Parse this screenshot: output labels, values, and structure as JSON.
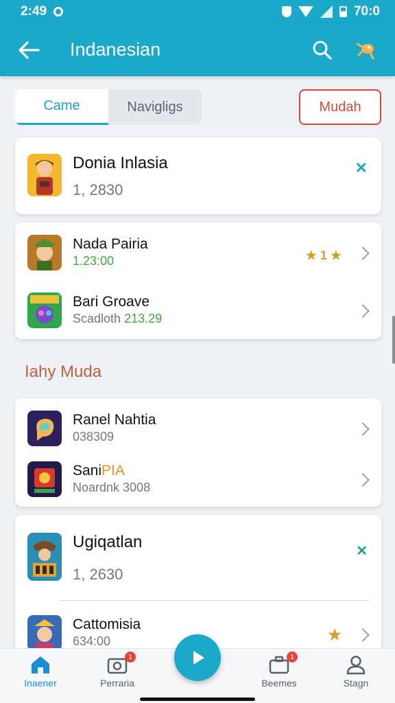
{
  "status_bar": {
    "time": "2:49",
    "battery_text": "70:0"
  },
  "app_bar": {
    "title": "Indanesian",
    "back_icon": "arrow-left-icon",
    "search_icon": "search-icon",
    "extra_icon": "bug-icon"
  },
  "tabs": [
    {
      "label": "Came",
      "active": true
    },
    {
      "label": "Navigligs",
      "active": false
    }
  ],
  "mudah_button": "Mudah",
  "featured": {
    "name": "Donia Inlasia",
    "sub": "1, 2830"
  },
  "list1": [
    {
      "name": "Nada Pairia",
      "sub": "1.23:00",
      "rating": "★ 1 ★"
    },
    {
      "name": "Bari Groave",
      "sub_a": "Scadloth",
      "sub_b": "213.29"
    }
  ],
  "section_title": "Iahy Muda",
  "list2": [
    {
      "name": "Ranel Nahtia",
      "sub": "038309"
    },
    {
      "name_a": "Sani",
      "name_b": "PIA",
      "sub": "Noardnk 3008"
    }
  ],
  "card3": {
    "name": "Ugiqatlan",
    "sub": "1, 2630"
  },
  "card3_item": {
    "name": "Cattomisia",
    "sub": "634:00",
    "rating": "★"
  },
  "bottom_nav": [
    {
      "label": "Inaener",
      "active": true
    },
    {
      "label": "Perraria",
      "badge": "1"
    },
    {
      "label": "Beemes",
      "badge": "1"
    },
    {
      "label": "Stagn"
    }
  ],
  "colors": {
    "primary": "#1aa9c9",
    "accent_red": "#d9473a",
    "section": "#c0603d"
  }
}
